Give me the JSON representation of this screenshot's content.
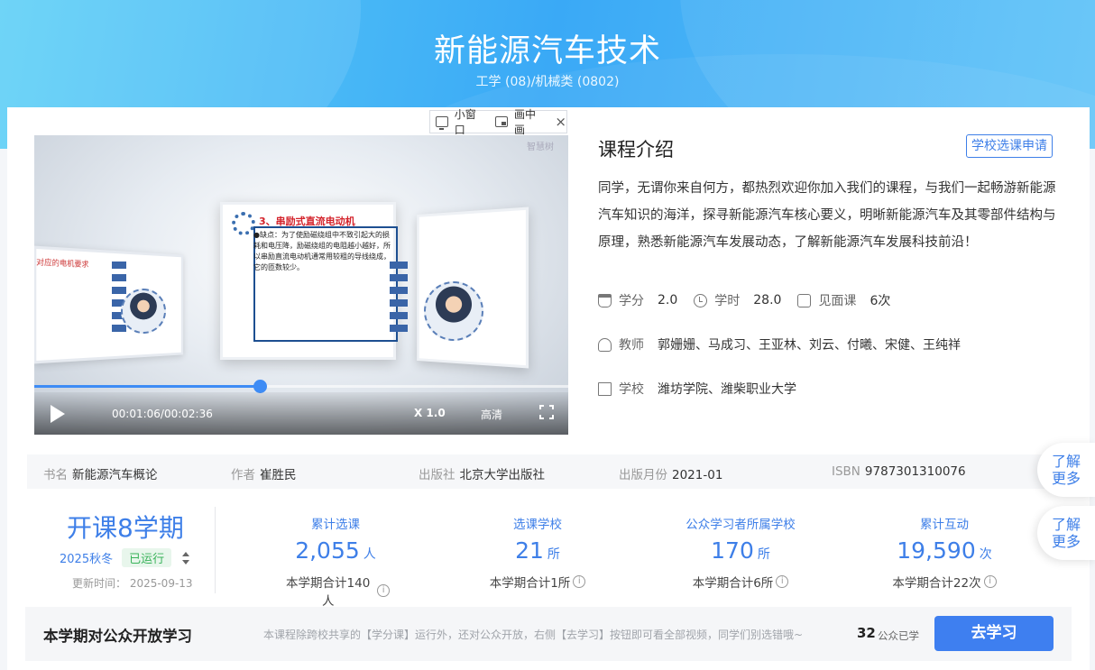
{
  "header": {
    "title": "新能源汽车技术",
    "subtitle": "工学 (08)/机械类 (0802)"
  },
  "mini_bar": {
    "small_window": "小窗口",
    "pip": "画中画",
    "close": "×"
  },
  "video": {
    "logo": "智慧树",
    "slide_heading": "3、串励式直流电动机",
    "slide_body": "●缺点：为了使励磁绕组中不致引起大的损耗和电压降，励磁绕组的电阻越小越好，所以串励直流电动机通常用较粗的导线绕成，它的匝数较少。",
    "slide_left_caption": "对应的电机要求",
    "time": "00:01:06/00:02:36",
    "speed": "X 1.0",
    "quality": "高清",
    "progress_fraction": 0.423
  },
  "intro": {
    "title": "课程介绍",
    "apply_button": "学校选课申请",
    "text": "同学，无谓你来自何方，都热烈欢迎你加入我们的课程，与我们一起畅游新能源汽车知识的海洋，探寻新能源汽车核心要义，明晰新能源汽车及其零部件结构与原理，熟悉新能源汽车发展动态，了解新能源汽车发展科技前沿！",
    "credit_label": "学分",
    "credit_value": "2.0",
    "hours_label": "学时",
    "hours_value": "28.0",
    "meet_label": "见面课",
    "meet_value": "6次",
    "teacher_label": "教师",
    "teacher_value": "郭姗姗、马成习、王亚林、刘云、付曦、宋健、王纯祥",
    "school_label": "学校",
    "school_value": "潍坊学院、潍柴职业大学"
  },
  "book": {
    "name_label": "书名",
    "name_value": "新能源汽车概论",
    "author_label": "作者",
    "author_value": "崔胜民",
    "publisher_label": "出版社",
    "publisher_value": "北京大学出版社",
    "date_label": "出版月份",
    "date_value": "2021-01",
    "isbn_label": "ISBN",
    "isbn_value": "9787301310076"
  },
  "more": {
    "label1": "了解",
    "label2": "更多"
  },
  "term": {
    "big": "开课8学期",
    "current": "2025秋冬",
    "status": "已运行",
    "update": "更新时间：  2025-09-13"
  },
  "stats": [
    {
      "label": "累计选课",
      "value": "2,055",
      "unit": "人",
      "total": "本学期合计140人"
    },
    {
      "label": "选课学校",
      "value": "21",
      "unit": "所",
      "total": "本学期合计1所"
    },
    {
      "label": "公众学习者所属学校",
      "value": "170",
      "unit": "所",
      "total": "本学期合计6所"
    },
    {
      "label": "累计互动",
      "value": "19,590",
      "unit": "次",
      "total": "本学期合计22次"
    }
  ],
  "bottom": {
    "title": "本学期对公众开放学习",
    "desc": "本课程除跨校共享的【学分课】运行外，还对公众开放，右侧【去学习】按钮即可看全部视频，同学们别选错哦~",
    "count": "32",
    "count_label": "公众已学",
    "go_button": "去学习"
  },
  "colors": {
    "accent": "#3e7fe8",
    "running": "#39b35a"
  }
}
